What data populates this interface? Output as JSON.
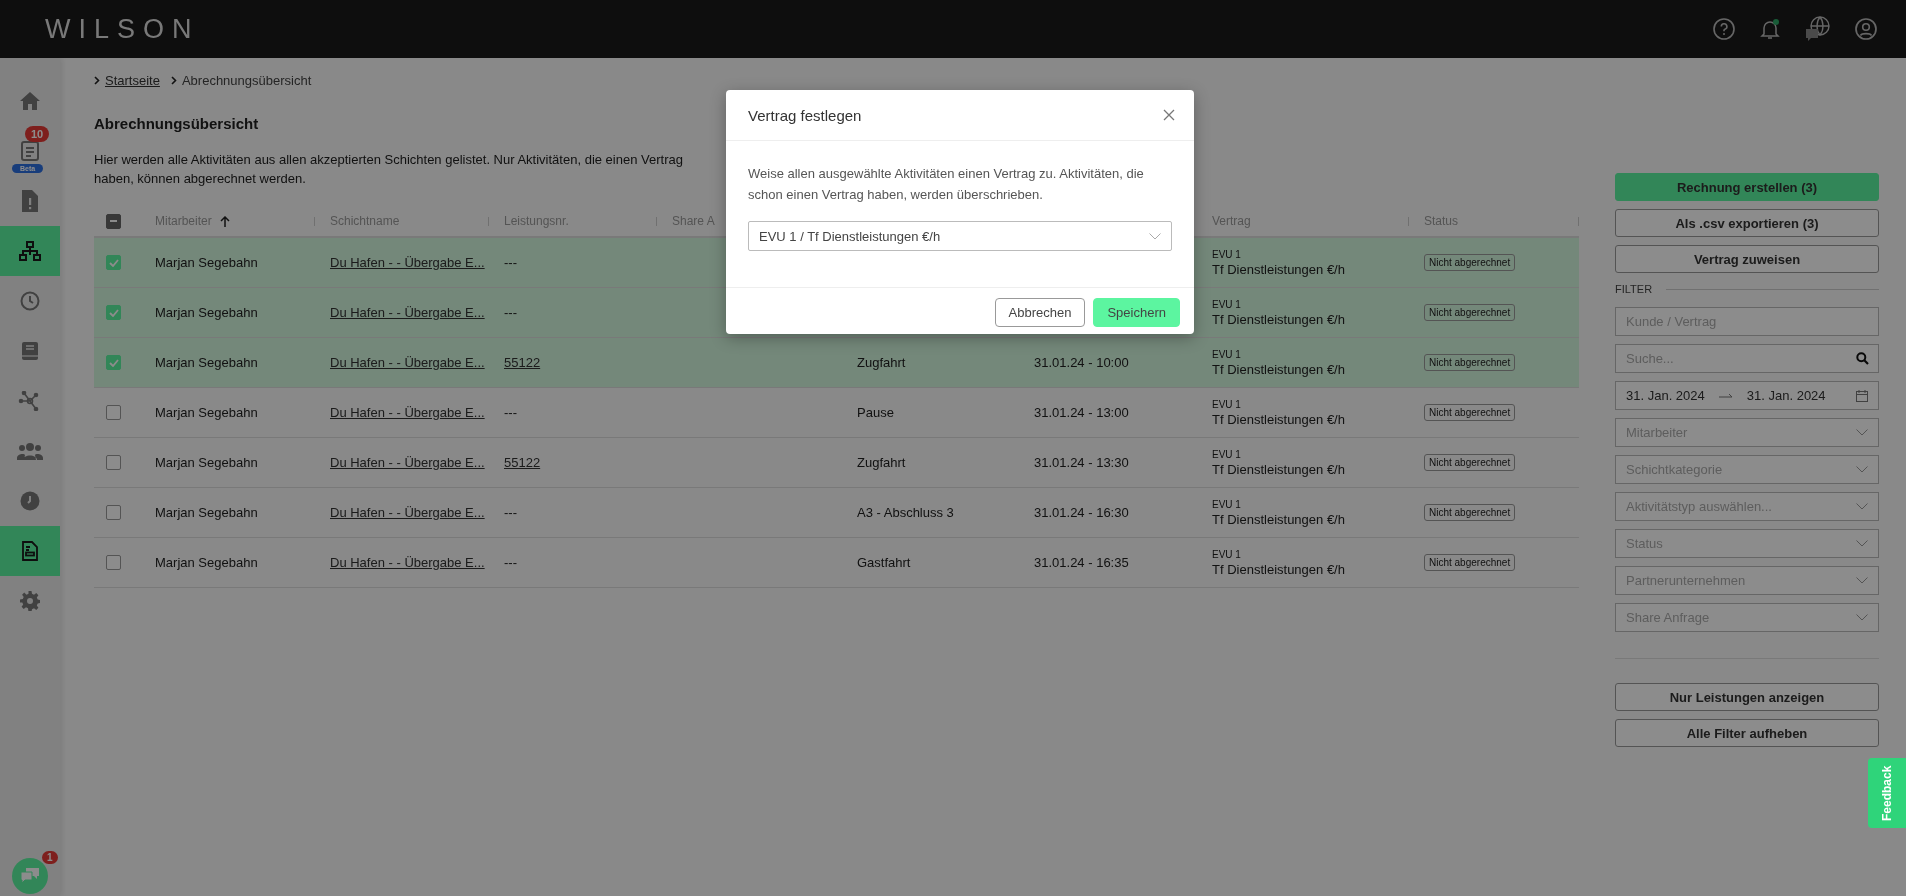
{
  "topbar": {
    "logo": "WILSON",
    "notification_dot": true
  },
  "sidebar": {
    "items": [
      {
        "kind": "home",
        "selected": false
      },
      {
        "kind": "document",
        "selected": false,
        "badge": "10",
        "tag": "Beta"
      },
      {
        "kind": "file-alert",
        "selected": false
      },
      {
        "kind": "network",
        "selected": true
      },
      {
        "kind": "clock",
        "selected": false
      },
      {
        "kind": "book",
        "selected": false
      },
      {
        "kind": "nodes",
        "selected": false
      },
      {
        "kind": "users",
        "selected": false
      },
      {
        "kind": "clock-filled",
        "selected": false
      },
      {
        "kind": "invoice",
        "selected": true
      },
      {
        "kind": "gear",
        "selected": false
      }
    ],
    "chat": {
      "badge": "1"
    }
  },
  "breadcrumb": [
    {
      "label": "Startseite",
      "link": true
    },
    {
      "label": "Abrechnungsübersicht",
      "link": false
    }
  ],
  "title": "Abrechnungsübersicht",
  "description": "Hier werden alle Aktivitäten aus allen akzeptierten Schichten gelistet. Nur Aktivitäten, die einen Vertrag haben, können abgerechnet werden.",
  "table": {
    "header_checkbox": {
      "indeterminate": true
    },
    "headers": {
      "employee": {
        "label": "Mitarbeiter",
        "sorted_ascending": true
      },
      "shift": "Schichtname",
      "service_no": "Leistungsnr.",
      "share": "Share A",
      "contract": "Vertrag",
      "status": "Status"
    },
    "rows": [
      {
        "selected": true,
        "employee": "Marjan Segebahn",
        "shift": "Du Hafen - - Übergabe E...",
        "service_no": "---",
        "service_link": false,
        "contract": [
          "EVU 1",
          "Tf Dienstleistungen €/h"
        ],
        "status": "Nicht abgerechnet"
      },
      {
        "selected": true,
        "employee": "Marjan Segebahn",
        "shift": "Du Hafen - - Übergabe E...",
        "service_no": "---",
        "service_link": false,
        "contract": [
          "EVU 1",
          "Tf Dienstleistungen €/h"
        ],
        "status": "Nicht abgerechnet"
      },
      {
        "selected": true,
        "employee": "Marjan Segebahn",
        "shift": "Du Hafen - - Übergabe E...",
        "service_no": "55122",
        "service_link": true,
        "activity": "Zugfahrt",
        "time": "31.01.24 - 10:00",
        "contract": [
          "EVU 1",
          "Tf Dienstleistungen €/h"
        ],
        "status": "Nicht abgerechnet"
      },
      {
        "selected": false,
        "employee": "Marjan Segebahn",
        "shift": "Du Hafen - - Übergabe E...",
        "service_no": "---",
        "service_link": false,
        "activity": "Pause",
        "time": "31.01.24 - 13:00",
        "contract": [
          "EVU 1",
          "Tf Dienstleistungen €/h"
        ],
        "status": "Nicht abgerechnet"
      },
      {
        "selected": false,
        "employee": "Marjan Segebahn",
        "shift": "Du Hafen - - Übergabe E...",
        "service_no": "55122",
        "service_link": true,
        "activity": "Zugfahrt",
        "time": "31.01.24 - 13:30",
        "contract": [
          "EVU 1",
          "Tf Dienstleistungen €/h"
        ],
        "status": "Nicht abgerechnet"
      },
      {
        "selected": false,
        "employee": "Marjan Segebahn",
        "shift": "Du Hafen - - Übergabe E...",
        "service_no": "---",
        "service_link": false,
        "activity": "A3 - Abschluss 3",
        "time": "31.01.24 - 16:30",
        "contract": [
          "EVU 1",
          "Tf Dienstleistungen €/h"
        ],
        "status": "Nicht abgerechnet"
      },
      {
        "selected": false,
        "employee": "Marjan Segebahn",
        "shift": "Du Hafen - - Übergabe E...",
        "service_no": "---",
        "service_link": false,
        "activity": "Gastfahrt",
        "time": "31.01.24 - 16:35",
        "contract": [
          "EVU 1",
          "Tf Dienstleistungen €/h"
        ],
        "status": "Nicht abgerechnet"
      }
    ]
  },
  "panel": {
    "actions": [
      {
        "label": "Rechnung erstellen (3)",
        "primary": true
      },
      {
        "label": "Als .csv exportieren (3)",
        "primary": false
      },
      {
        "label": "Vertrag zuweisen",
        "primary": false
      }
    ],
    "filter_label": "FILTER",
    "filters": [
      {
        "kind": "text",
        "placeholder": "Kunde / Vertrag"
      },
      {
        "kind": "search",
        "placeholder": "Suche..."
      },
      {
        "kind": "daterange",
        "from": "31. Jan. 2024",
        "to": "31. Jan. 2024"
      },
      {
        "kind": "select",
        "placeholder": "Mitarbeiter"
      },
      {
        "kind": "select",
        "placeholder": "Schichtkategorie"
      },
      {
        "kind": "select",
        "placeholder": "Aktivitätstyp auswählen..."
      },
      {
        "kind": "select",
        "placeholder": "Status"
      },
      {
        "kind": "select",
        "placeholder": "Partnerunternehmen"
      },
      {
        "kind": "select",
        "placeholder": "Share Anfrage"
      }
    ],
    "bottom_actions": [
      "Nur Leistungen anzeigen",
      "Alle Filter aufheben"
    ]
  },
  "feedback": "Feedback",
  "modal": {
    "title": "Vertrag festlegen",
    "text": "Weise allen ausgewählte Aktivitäten einen Vertrag zu. Aktivitäten, die schon einen Vertrag haben, werden überschrieben.",
    "select_value": "EVU 1 / Tf Dienstleistungen €/h",
    "cancel": "Abbrechen",
    "save": "Speichern"
  }
}
